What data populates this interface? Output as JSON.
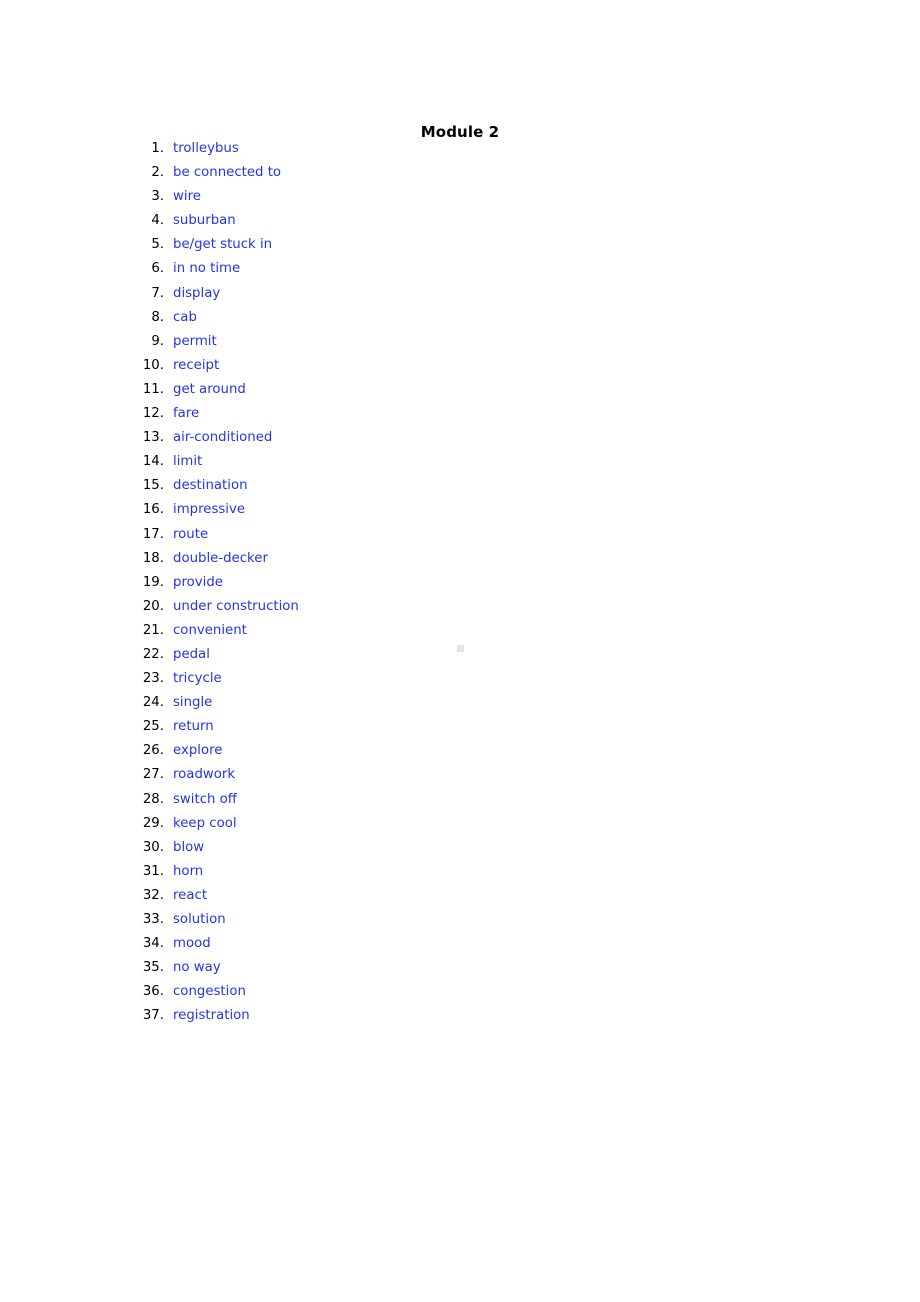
{
  "document": {
    "title": "Module 2",
    "page_background": "#ffffff",
    "title_color": "#000000",
    "term_color": "#2435E8",
    "number_color": "#000000",
    "artifact_color": "#e4e4e6"
  },
  "vocabulary": {
    "count": 37,
    "items": [
      {
        "number": "1.",
        "term": "trolleybus"
      },
      {
        "number": "2.",
        "term": "be connected to"
      },
      {
        "number": "3.",
        "term": "wire"
      },
      {
        "number": "4.",
        "term": "suburban"
      },
      {
        "number": "5.",
        "term": "be/get stuck in"
      },
      {
        "number": "6.",
        "term": "in no time"
      },
      {
        "number": "7.",
        "term": "display"
      },
      {
        "number": "8.",
        "term": "cab"
      },
      {
        "number": "9.",
        "term": "permit"
      },
      {
        "number": "10.",
        "term": "receipt"
      },
      {
        "number": "11.",
        "term": "get around"
      },
      {
        "number": "12.",
        "term": "fare"
      },
      {
        "number": "13.",
        "term": "air-conditioned"
      },
      {
        "number": "14.",
        "term": "limit"
      },
      {
        "number": "15.",
        "term": "destination"
      },
      {
        "number": "16.",
        "term": "impressive"
      },
      {
        "number": "17.",
        "term": "route"
      },
      {
        "number": "18.",
        "term": "double-decker"
      },
      {
        "number": "19.",
        "term": "provide"
      },
      {
        "number": "20.",
        "term": "under construction"
      },
      {
        "number": "21.",
        "term": "convenient"
      },
      {
        "number": "22.",
        "term": "pedal"
      },
      {
        "number": "23.",
        "term": "tricycle"
      },
      {
        "number": "24.",
        "term": "single"
      },
      {
        "number": "25.",
        "term": "return"
      },
      {
        "number": "26.",
        "term": "explore"
      },
      {
        "number": "27.",
        "term": "roadwork"
      },
      {
        "number": "28.",
        "term": "switch off"
      },
      {
        "number": "29.",
        "term": "keep cool"
      },
      {
        "number": "30.",
        "term": "blow"
      },
      {
        "number": "31.",
        "term": "horn"
      },
      {
        "number": "32.",
        "term": "react"
      },
      {
        "number": "33.",
        "term": "solution"
      },
      {
        "number": "34.",
        "term": "mood"
      },
      {
        "number": "35.",
        "term": "no way"
      },
      {
        "number": "36.",
        "term": "congestion"
      },
      {
        "number": "37.",
        "term": "registration"
      }
    ]
  }
}
